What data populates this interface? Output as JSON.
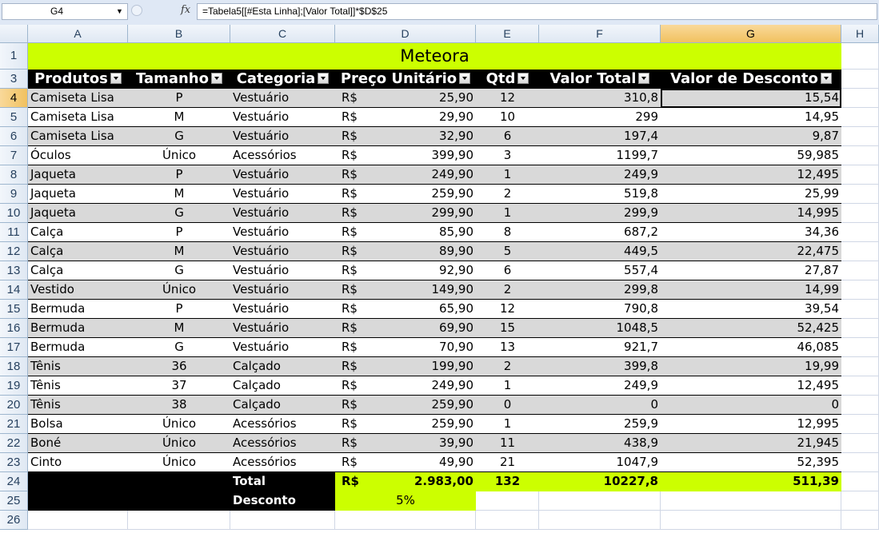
{
  "formula_bar": {
    "name_box": "G4",
    "fx_label": "fx",
    "formula": "=Tabela5[[#Esta Linha];[Valor Total]]*$D$25"
  },
  "columns": [
    "A",
    "B",
    "C",
    "D",
    "E",
    "F",
    "G",
    "H"
  ],
  "rows": [
    "1",
    "2",
    "3",
    "4",
    "5",
    "6",
    "7",
    "8",
    "9",
    "10",
    "11",
    "12",
    "13",
    "14",
    "15",
    "16",
    "17",
    "18",
    "19",
    "20",
    "21",
    "22",
    "23",
    "24",
    "25",
    "26"
  ],
  "title": "Meteora",
  "table_headers": {
    "produtos": "Produtos",
    "tamanho": "Tamanho",
    "categoria": "Categoria",
    "preco": "Preço Unitário",
    "qtd": "Qtd",
    "valor_total": "Valor Total",
    "desconto": "Valor de Desconto"
  },
  "currency": "R$",
  "table_rows": [
    {
      "produto": "Camiseta Lisa",
      "tamanho": "P",
      "categoria": "Vestuário",
      "preco": "25,90",
      "qtd": "12",
      "total": "310,8",
      "desconto": "15,54"
    },
    {
      "produto": "Camiseta Lisa",
      "tamanho": "M",
      "categoria": "Vestuário",
      "preco": "29,90",
      "qtd": "10",
      "total": "299",
      "desconto": "14,95"
    },
    {
      "produto": "Camiseta Lisa",
      "tamanho": "G",
      "categoria": "Vestuário",
      "preco": "32,90",
      "qtd": "6",
      "total": "197,4",
      "desconto": "9,87"
    },
    {
      "produto": "Óculos",
      "tamanho": "Único",
      "categoria": "Acessórios",
      "preco": "399,90",
      "qtd": "3",
      "total": "1199,7",
      "desconto": "59,985"
    },
    {
      "produto": "Jaqueta",
      "tamanho": "P",
      "categoria": "Vestuário",
      "preco": "249,90",
      "qtd": "1",
      "total": "249,9",
      "desconto": "12,495"
    },
    {
      "produto": "Jaqueta",
      "tamanho": "M",
      "categoria": "Vestuário",
      "preco": "259,90",
      "qtd": "2",
      "total": "519,8",
      "desconto": "25,99"
    },
    {
      "produto": "Jaqueta",
      "tamanho": "G",
      "categoria": "Vestuário",
      "preco": "299,90",
      "qtd": "1",
      "total": "299,9",
      "desconto": "14,995"
    },
    {
      "produto": "Calça",
      "tamanho": "P",
      "categoria": "Vestuário",
      "preco": "85,90",
      "qtd": "8",
      "total": "687,2",
      "desconto": "34,36"
    },
    {
      "produto": "Calça",
      "tamanho": "M",
      "categoria": "Vestuário",
      "preco": "89,90",
      "qtd": "5",
      "total": "449,5",
      "desconto": "22,475"
    },
    {
      "produto": "Calça",
      "tamanho": "G",
      "categoria": "Vestuário",
      "preco": "92,90",
      "qtd": "6",
      "total": "557,4",
      "desconto": "27,87"
    },
    {
      "produto": "Vestido",
      "tamanho": "Único",
      "categoria": "Vestuário",
      "preco": "149,90",
      "qtd": "2",
      "total": "299,8",
      "desconto": "14,99"
    },
    {
      "produto": "Bermuda",
      "tamanho": "P",
      "categoria": "Vestuário",
      "preco": "65,90",
      "qtd": "12",
      "total": "790,8",
      "desconto": "39,54"
    },
    {
      "produto": "Bermuda",
      "tamanho": "M",
      "categoria": "Vestuário",
      "preco": "69,90",
      "qtd": "15",
      "total": "1048,5",
      "desconto": "52,425"
    },
    {
      "produto": "Bermuda",
      "tamanho": "G",
      "categoria": "Vestuário",
      "preco": "70,90",
      "qtd": "13",
      "total": "921,7",
      "desconto": "46,085"
    },
    {
      "produto": "Tênis",
      "tamanho": "36",
      "categoria": "Calçado",
      "preco": "199,90",
      "qtd": "2",
      "total": "399,8",
      "desconto": "19,99"
    },
    {
      "produto": "Tênis",
      "tamanho": "37",
      "categoria": "Calçado",
      "preco": "249,90",
      "qtd": "1",
      "total": "249,9",
      "desconto": "12,495"
    },
    {
      "produto": "Tênis",
      "tamanho": "38",
      "categoria": "Calçado",
      "preco": "259,90",
      "qtd": "0",
      "total": "0",
      "desconto": "0"
    },
    {
      "produto": "Bolsa",
      "tamanho": "Único",
      "categoria": "Acessórios",
      "preco": "259,90",
      "qtd": "1",
      "total": "259,9",
      "desconto": "12,995"
    },
    {
      "produto": "Boné",
      "tamanho": "Único",
      "categoria": "Acessórios",
      "preco": "39,90",
      "qtd": "11",
      "total": "438,9",
      "desconto": "21,945"
    },
    {
      "produto": "Cinto",
      "tamanho": "Único",
      "categoria": "Acessórios",
      "preco": "49,90",
      "qtd": "21",
      "total": "1047,9",
      "desconto": "52,395"
    }
  ],
  "totals": {
    "label": "Total",
    "currency": "R$",
    "preco": "2.983,00",
    "qtd": "132",
    "total": "10227,8",
    "desconto": "511,39"
  },
  "discount": {
    "label": "Desconto",
    "value": "5%"
  },
  "colors": {
    "title_fill": "#ccff00",
    "header_fill": "#000000",
    "band_fill": "#d9d9d9",
    "selected_header": "#f1c15f"
  },
  "selected_cell": "G4",
  "selected_column": "G",
  "selected_row": "4"
}
